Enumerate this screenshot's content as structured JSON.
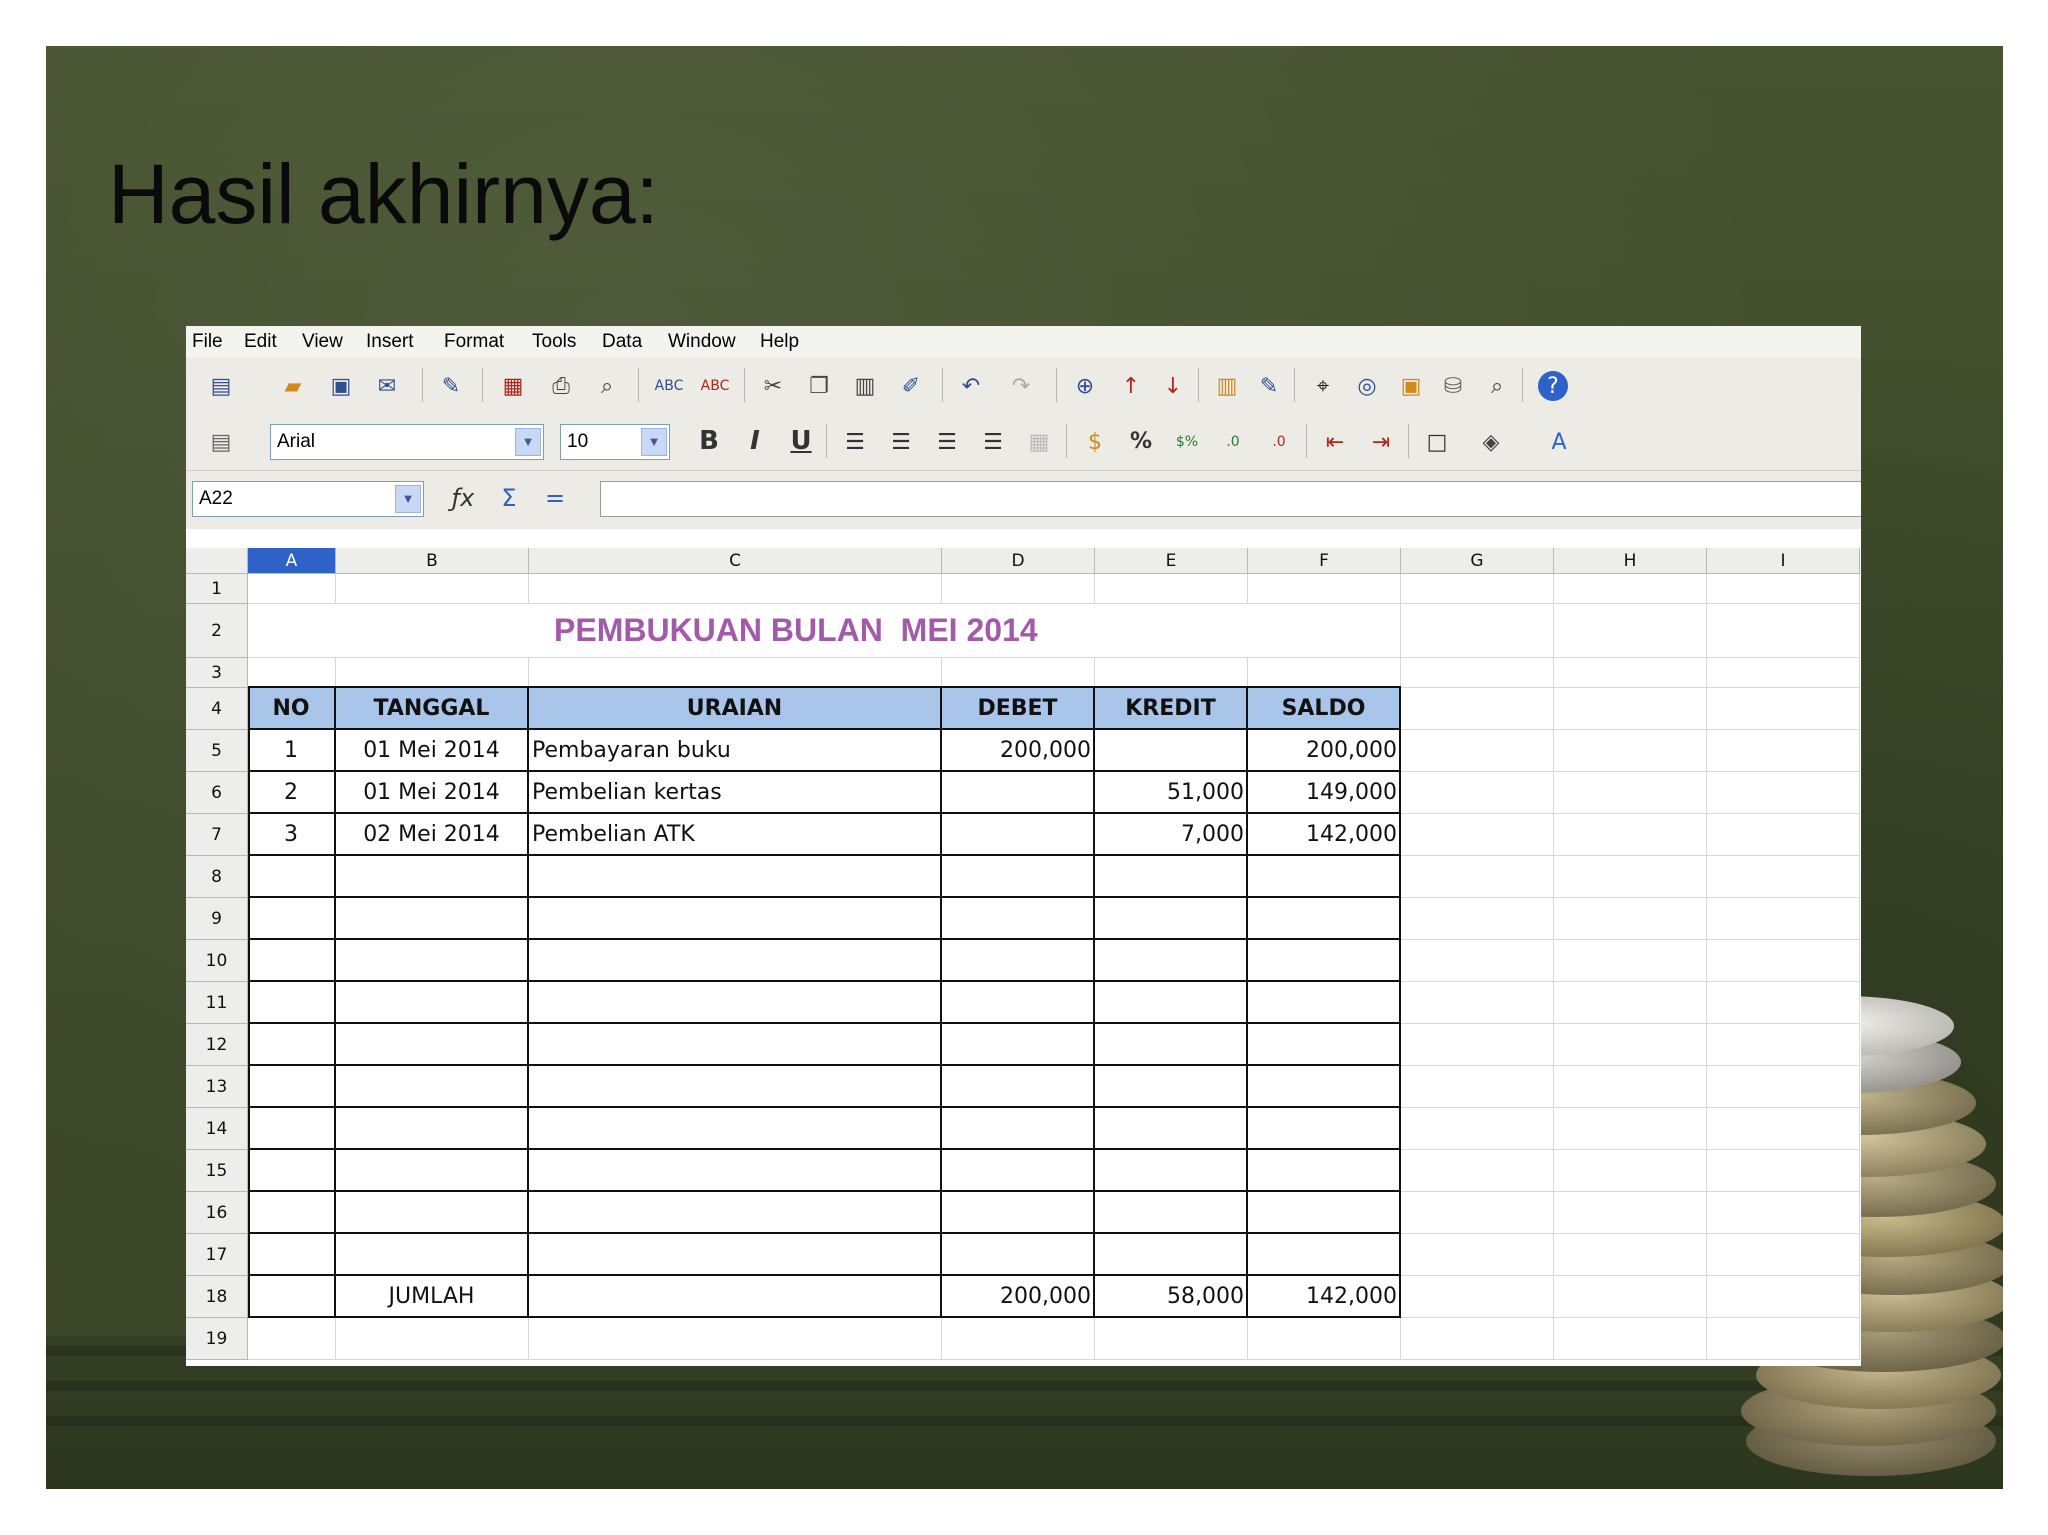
{
  "slide": {
    "title": "Hasil akhirnya:"
  },
  "menu": [
    "File",
    "Edit",
    "View",
    "Insert",
    "Format",
    "Tools",
    "Data",
    "Window",
    "Help"
  ],
  "toolbar": {
    "font_name": "Arial",
    "font_size": "10",
    "bold": "B",
    "italic": "I",
    "underline": "U",
    "percent": "%"
  },
  "formula_bar": {
    "name_box": "A22",
    "formula": ""
  },
  "columns": [
    "A",
    "B",
    "C",
    "D",
    "E",
    "F",
    "G",
    "H",
    "I"
  ],
  "rows": [
    "1",
    "2",
    "3",
    "4",
    "5",
    "6",
    "7",
    "8",
    "9",
    "10",
    "11",
    "12",
    "13",
    "14",
    "15",
    "16",
    "17",
    "18",
    "19"
  ],
  "sheet": {
    "title": "PEMBUKUAN BULAN  MEI 2014",
    "headers": [
      "NO",
      "TANGGAL",
      "URAIAN",
      "DEBET",
      "KREDIT",
      "SALDO"
    ],
    "entries": [
      {
        "no": "1",
        "tanggal": "01 Mei 2014",
        "uraian": "Pembayaran buku",
        "debet": "200,000",
        "kredit": "",
        "saldo": "200,000"
      },
      {
        "no": "2",
        "tanggal": "01 Mei 2014",
        "uraian": "Pembelian kertas",
        "debet": "",
        "kredit": "51,000",
        "saldo": "149,000"
      },
      {
        "no": "3",
        "tanggal": "02 Mei 2014",
        "uraian": "Pembelian ATK",
        "debet": "",
        "kredit": "7,000",
        "saldo": "142,000"
      }
    ],
    "total": {
      "label": "JUMLAH",
      "debet": "200,000",
      "kredit": "58,000",
      "saldo": "142,000"
    }
  },
  "colors": {
    "header_fill": "#a9c6ea",
    "title_color": "#a35aa8",
    "active_column": "#2f62c9"
  }
}
